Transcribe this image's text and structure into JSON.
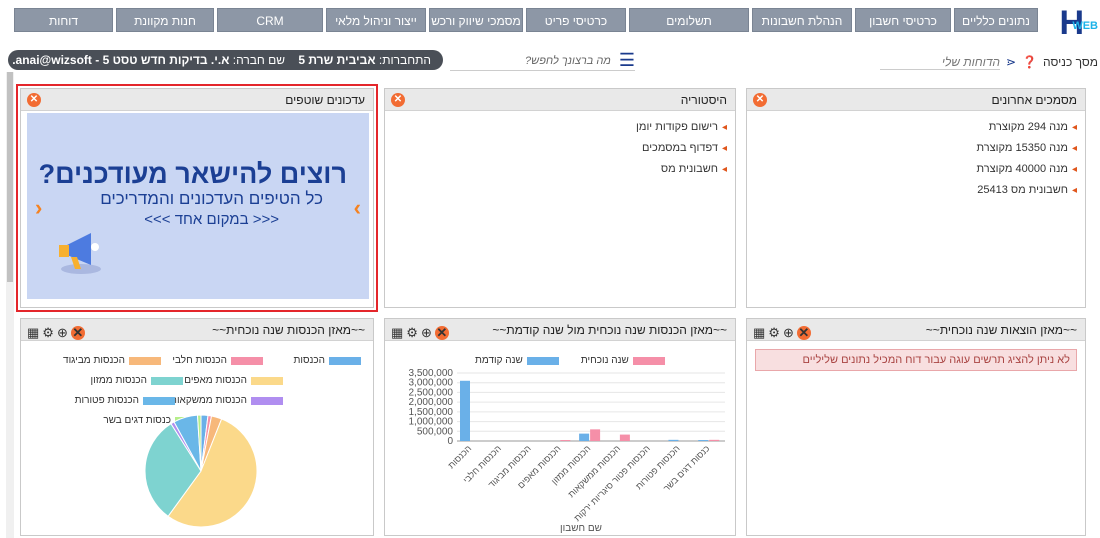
{
  "nav": {
    "tabs": [
      "נתונים כלליים",
      "כרטיסי חשבון",
      "הנהלת חשבונות",
      "תשלומים",
      "כרטיסי פריט",
      "מסמכי שיווק ורכש",
      "ייצור וניהול מלאי",
      "CRM",
      "חנות מקוונת",
      "דוחות"
    ],
    "logo_web": "WEB",
    "logo_h": "H"
  },
  "bar2": {
    "home": "מסך כניסה",
    "my_reports": "הדוחות שלי",
    "search_placeholder": "מה ברצונך לחפש?",
    "login_label": "התחברות:",
    "login_value": "אביבית שרת 5",
    "company_label": "שם חברה:",
    "company_value": "א.י. בדיקות חדש טסט 5 - anai@wizsoft."
  },
  "panels": {
    "recent_docs": {
      "title": "מסמכים אחרונים",
      "items": [
        "מנה 294 מקוצרת",
        "מנה 15350 מקוצרת",
        "מנה 40000 מקוצרת",
        "חשבונית מס 25413"
      ]
    },
    "history": {
      "title": "היסטוריה",
      "items": [
        "רישום פקודות יומן",
        "דפדוף במסמכים",
        "חשבונית מס"
      ]
    },
    "updates": {
      "title": "עדכונים שוטפים",
      "banner_l1": "רוצים להישאר מעודכנים?",
      "banner_l2": "כל הטיפים העדכונים והמדריכים",
      "banner_l3": "<<< במקום אחד >>>"
    },
    "expenses": {
      "title": "~~מאזן הוצאות שנה נוכחית~~",
      "alert": "לא ניתן להציג תרשים עוגה עבור דוח המכיל נתונים שליליים"
    },
    "income_compare": {
      "title": "~~מאזן הכנסות שנה נוכחית מול שנה קודמת~~"
    },
    "income_current": {
      "title": "~~מאזן הכנסות שנה נוכחית~~"
    }
  },
  "chart_data": [
    {
      "type": "bar",
      "categories": [
        "הכנסות",
        "הכנסות חלבי",
        "הכנסות מביגוד",
        "הכנסות מאפים",
        "הכנסות ממזון",
        "הכנסות ממשקאות",
        "הכנסות פטור סיגריות ירקות",
        "הכנסות פטורות",
        "כנסות דגים בשר"
      ],
      "series": [
        {
          "name": "שנה קודמת",
          "color": "#6ab0e8",
          "values": [
            3100000,
            0,
            0,
            0,
            380000,
            0,
            0,
            60000,
            50000
          ]
        },
        {
          "name": "שנה נוכחית",
          "color": "#f58fa8",
          "values": [
            0,
            0,
            0,
            50000,
            600000,
            330000,
            0,
            0,
            60000
          ]
        }
      ],
      "yticks": [
        "0",
        "500,000",
        "1,000,000",
        "1,500,000",
        "2,000,000",
        "2,500,000",
        "3,000,000",
        "3,500,000"
      ],
      "ylim": [
        0,
        3500000
      ],
      "xlabel": "שם חשבון"
    },
    {
      "type": "pie",
      "labels": [
        "הכנסות",
        "הכנסות חלבי",
        "הכנסות מביגוד",
        "הכנסות מאפים",
        "הכנסות ממזון",
        "הכנסות ממשקאות",
        "הכנסות פטורות",
        "כנסות דגים בשר"
      ],
      "colors": [
        "#6ab0e8",
        "#f58fa8",
        "#f7b87a",
        "#fbd98a",
        "#7ed3d0",
        "#b08ef0",
        "#6ab7e8",
        "#b6ee8a"
      ],
      "values": [
        2,
        1,
        3,
        54,
        31,
        1,
        7,
        1
      ]
    }
  ]
}
